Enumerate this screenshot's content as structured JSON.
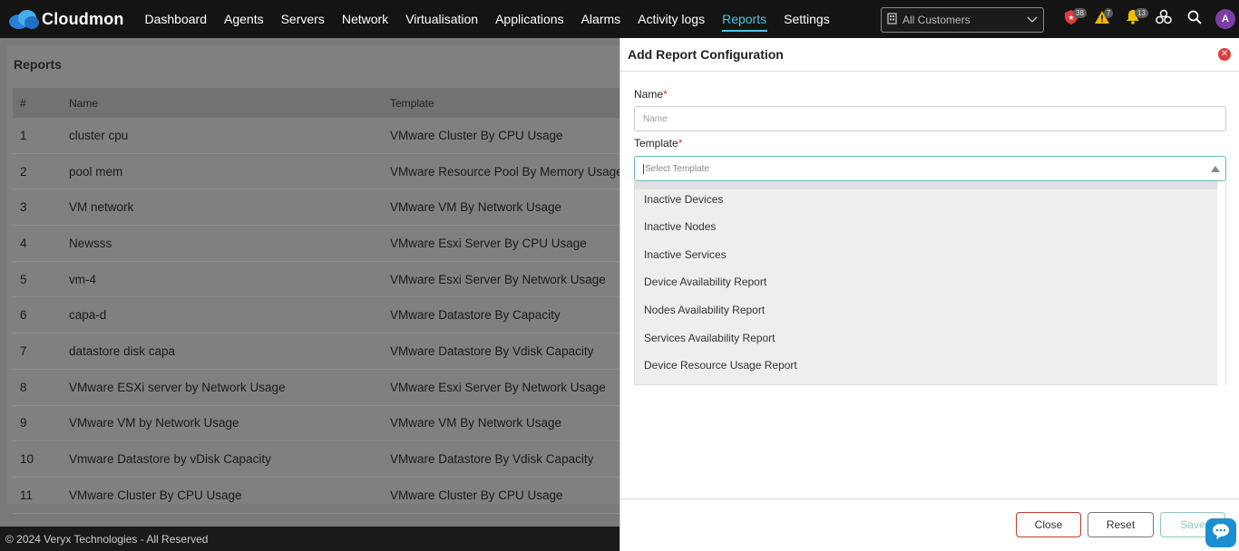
{
  "brand": {
    "name": "Cloudmon"
  },
  "nav": [
    {
      "label": "Dashboard"
    },
    {
      "label": "Agents"
    },
    {
      "label": "Servers"
    },
    {
      "label": "Network"
    },
    {
      "label": "Virtualisation"
    },
    {
      "label": "Applications"
    },
    {
      "label": "Alarms"
    },
    {
      "label": "Activity logs"
    },
    {
      "label": "Reports",
      "active": true
    },
    {
      "label": "Settings"
    }
  ],
  "customer_select": {
    "value": "All Customers"
  },
  "top_icons": [
    {
      "name": "shield-alert-icon",
      "badge": "38",
      "color": "#e03a3a"
    },
    {
      "name": "warning-icon",
      "badge": "7",
      "color": "#f0b400"
    },
    {
      "name": "bell-icon",
      "badge": "13",
      "color": "#f0c000"
    },
    {
      "name": "integrations-icon",
      "badge": ""
    },
    {
      "name": "search-icon",
      "badge": ""
    }
  ],
  "user": {
    "initial": "A"
  },
  "reports": {
    "title": "Reports",
    "columns": [
      "#",
      "Name",
      "Template"
    ],
    "rows": [
      [
        "1",
        "cluster cpu",
        "VMware Cluster By CPU Usage"
      ],
      [
        "2",
        "pool mem",
        "VMware Resource Pool By Memory Usage"
      ],
      [
        "3",
        "VM network",
        "VMware VM By Network Usage"
      ],
      [
        "4",
        "Newsss",
        "VMware Esxi Server By CPU Usage"
      ],
      [
        "5",
        "vm-4",
        "VMware Esxi Server By Network Usage"
      ],
      [
        "6",
        "capa-d",
        "VMware Datastore By Capacity"
      ],
      [
        "7",
        "datastore disk capa",
        "VMware Datastore By Vdisk Capacity"
      ],
      [
        "8",
        "VMware ESXi server by Network Usage",
        "VMware Esxi Server By Network Usage"
      ],
      [
        "9",
        "VMware VM by Network Usage",
        "VMware VM By Network Usage"
      ],
      [
        "10",
        "Vmware Datastore by vDisk Capacity",
        "VMware Datastore By Vdisk Capacity"
      ],
      [
        "11",
        "VMware Cluster By CPU Usage",
        "VMware Cluster By CPU Usage"
      ]
    ]
  },
  "footer": {
    "text": "© 2024 Veryx Technologies - All Reserved"
  },
  "panel": {
    "title": "Add Report Configuration",
    "name_label": "Name",
    "name_placeholder": "Name",
    "template_label": "Template",
    "template_placeholder": "Select Template",
    "required_mark": "*",
    "options": [
      "Inactive Devices",
      "Inactive Nodes",
      "Inactive Services",
      "Device Availability Report",
      "Nodes Availability Report",
      "Services Availability Report",
      "Device Resource Usage Report"
    ],
    "buttons": {
      "close": "Close",
      "reset": "Reset",
      "save": "Save"
    }
  },
  "colors": {
    "accent": "#4fc3e0",
    "topbar": "#141414",
    "avatar": "#7b3fa3",
    "danger": "#e23b3b",
    "chat": "#1c8fd0"
  }
}
